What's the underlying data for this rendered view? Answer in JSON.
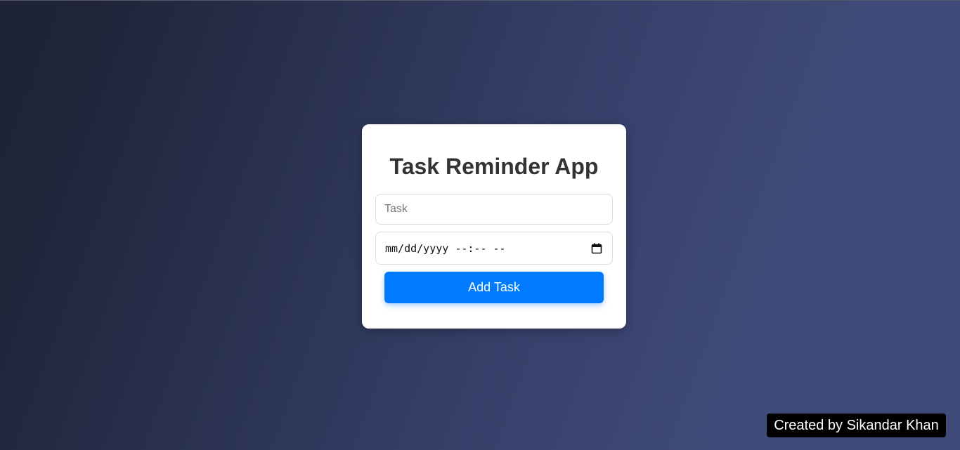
{
  "app": {
    "title": "Task Reminder App"
  },
  "form": {
    "task_placeholder": "Task",
    "task_value": "",
    "datetime_placeholder": "mm/dd/yyyy --:-- --",
    "datetime_icon": "calendar-icon",
    "add_button_label": "Add Task"
  },
  "footer": {
    "credit": "Created by Sikandar Khan"
  },
  "colors": {
    "accent": "#007bff",
    "card": "#ffffff",
    "background_start": "#1e2337",
    "background_end": "#3f4b78"
  }
}
